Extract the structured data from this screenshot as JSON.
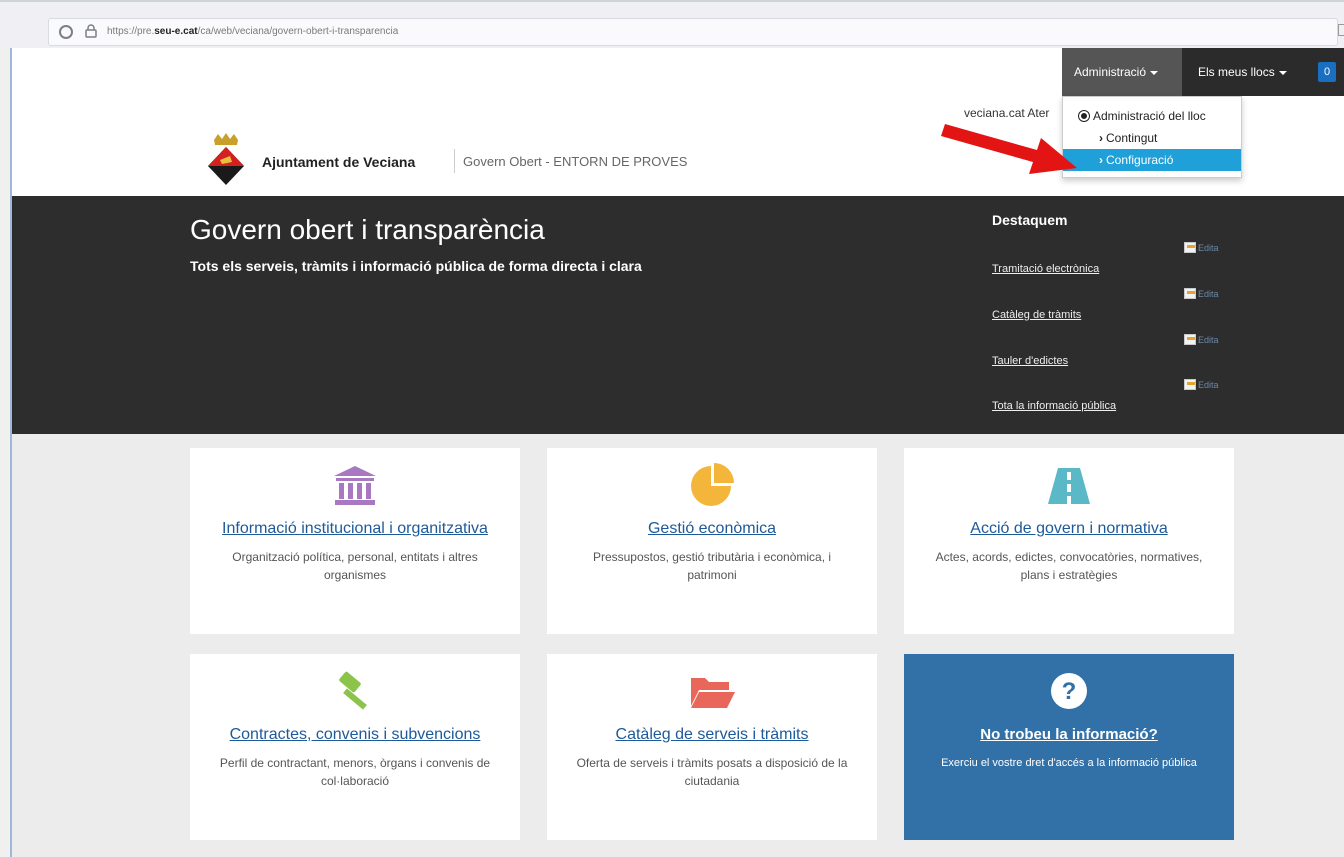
{
  "browser": {
    "url_prefix": "https://pre.",
    "url_domain": "seu-e.cat",
    "url_path": "/ca/web/veciana/govern-obert-i-transparencia"
  },
  "admin_bar": {
    "admin_label": "Administració",
    "sites_label": "Els meus llocs",
    "badge_count": "0"
  },
  "dropdown": {
    "header": "Administració del lloc",
    "items": [
      "Contingut",
      "Configuració"
    ]
  },
  "top_links": "veciana.cat  Ater",
  "header": {
    "site_name": "Ajuntament de Veciana",
    "subtitle": "Govern Obert - ENTORN DE PROVES"
  },
  "hero": {
    "title": "Govern obert i transparència",
    "subtitle": "Tots els serveis, tràmits i informació pública de forma directa i clara",
    "featured_title": "Destaquem",
    "edit_label": "Edita",
    "links": [
      "Tramitació electrònica",
      "Catàleg de tràmits",
      "Tauler d'edictes",
      "Tota la informació pública"
    ]
  },
  "cards": [
    {
      "title": "Informació institucional i organitzativa",
      "desc": "Organització política, personal, entitats i altres organismes",
      "icon": "institution-icon",
      "color": "#a879c1"
    },
    {
      "title": "Gestió econòmica",
      "desc": "Pressupostos, gestió tributària i econòmica, i patrimoni",
      "icon": "pie-chart-icon",
      "color": "#f3b63a"
    },
    {
      "title": "Acció de govern i normativa",
      "desc": "Actes, acords, edictes, convocatòries, normatives, plans i estratègies",
      "icon": "road-icon",
      "color": "#5bb8c7"
    },
    {
      "title": "Contractes, convenis i subvencions",
      "desc": "Perfil de contractant, menors, òrgans i convenis de col·laboració",
      "icon": "gavel-icon",
      "color": "#8cc34a"
    },
    {
      "title": "Catàleg de serveis i tràmits",
      "desc": "Oferta de serveis i tràmits posats a disposició de la ciutadania",
      "icon": "folder-open-icon",
      "color": "#e8665a"
    },
    {
      "title": "No trobeu la informació?",
      "desc": "Exerciu el vostre dret d'accés a la informació pública",
      "icon": "question-circle-icon",
      "color": "#ffffff"
    }
  ]
}
